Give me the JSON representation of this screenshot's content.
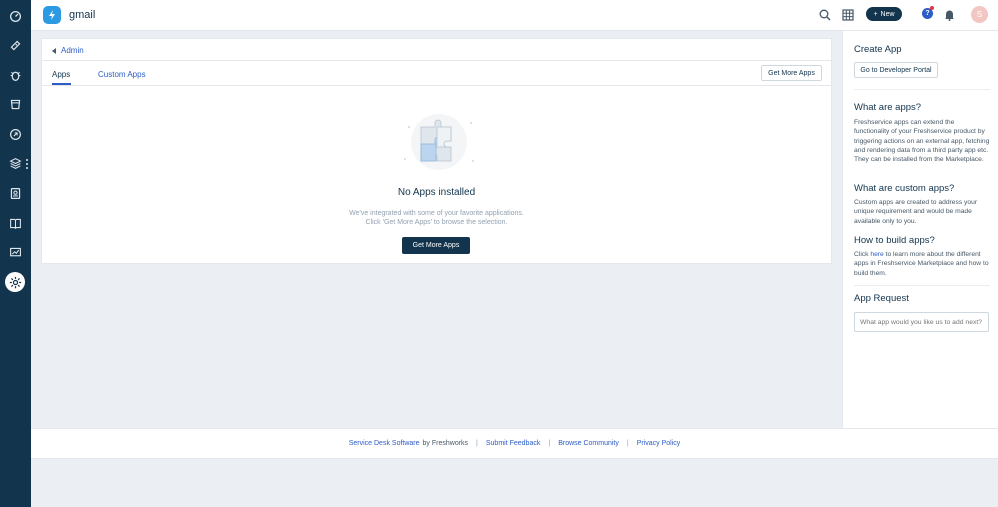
{
  "header": {
    "workspace_name": "gmail",
    "new_button_label": "New",
    "avatar_initial": "S",
    "help_label": "?"
  },
  "sidebar": {
    "items": [
      {
        "icon": "dashboard-icon"
      },
      {
        "icon": "tickets-icon"
      },
      {
        "icon": "problems-icon"
      },
      {
        "icon": "changes-icon"
      },
      {
        "icon": "releases-icon"
      },
      {
        "icon": "assets-icon"
      },
      {
        "icon": "contracts-icon"
      },
      {
        "icon": "solutions-icon"
      },
      {
        "icon": "reports-icon"
      },
      {
        "icon": "admin-gear-icon",
        "active": true
      }
    ]
  },
  "main": {
    "breadcrumb": "Admin",
    "tabs": [
      {
        "label": "Apps",
        "active": true
      },
      {
        "label": "Custom Apps",
        "active": false
      }
    ],
    "get_more_apps_top": "Get More Apps",
    "empty_state": {
      "title": "No Apps installed",
      "line1": "We've integrated with some of your favorite applications.",
      "line2": "Click 'Get More Apps' to browse the selection.",
      "button": "Get More Apps"
    }
  },
  "right_panel": {
    "create_app_title": "Create App",
    "developer_portal_button": "Go to Developer Portal",
    "what_are_apps_title": "What are apps?",
    "what_are_apps_text": "Freshservice apps can extend the functionality of your Freshservice product by triggering actions on an external app, fetching and rendering data from a third party app etc. They can be installed from the Marketplace.",
    "custom_apps_title": "What are custom apps?",
    "custom_apps_text": "Custom apps are created to address your unique requirement and would be made available only to you.",
    "build_apps_title": "How to build apps?",
    "build_apps_prefix": "Click",
    "build_apps_link": "here",
    "build_apps_suffix": "to learn more about the different apps in Freshservice Marketplace and how to build them.",
    "app_request_title": "App Request",
    "app_request_placeholder": "What app would you like us to add next?"
  },
  "footer": {
    "service_desk_link": "Service Desk Software",
    "by_text": "by Freshworks",
    "submit_feedback": "Submit Feedback",
    "browse_community": "Browse Community",
    "privacy_policy": "Privacy Policy",
    "separator": "|"
  },
  "colors": {
    "sidebar": "#12344d",
    "accent": "#2c5cc5",
    "brand": "#2c9ae2",
    "background": "#ebeff3"
  }
}
